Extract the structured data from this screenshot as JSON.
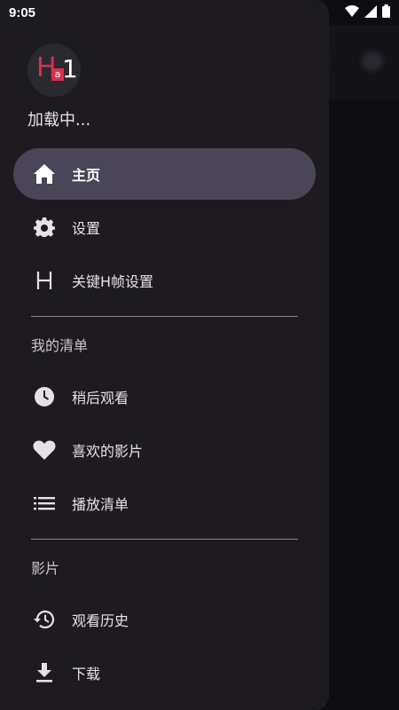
{
  "status_bar": {
    "time": "9:05",
    "icons": [
      "wifi-icon",
      "signal-icon",
      "battery-icon"
    ]
  },
  "drawer": {
    "header": {
      "loading_text": "加载中..."
    },
    "main_items": [
      {
        "label": "主页",
        "icon": "home-icon",
        "selected": true
      },
      {
        "label": "设置",
        "icon": "gear-icon",
        "selected": false
      },
      {
        "label": "关键H帧设置",
        "icon": "h-letter-icon",
        "selected": false
      }
    ],
    "sections": [
      {
        "title": "我的清单",
        "items": [
          {
            "label": "稍后观看",
            "icon": "clock-icon"
          },
          {
            "label": "喜欢的影片",
            "icon": "heart-icon"
          },
          {
            "label": "播放清单",
            "icon": "playlist-icon"
          }
        ]
      },
      {
        "title": "影片",
        "items": [
          {
            "label": "观看历史",
            "icon": "history-icon"
          },
          {
            "label": "下载",
            "icon": "download-icon"
          }
        ]
      }
    ]
  },
  "colors": {
    "drawer_bg": "#1d1b20",
    "selected_bg": "#4b4558",
    "logo_red": "#d92f4f",
    "background": "#0d0c10"
  }
}
